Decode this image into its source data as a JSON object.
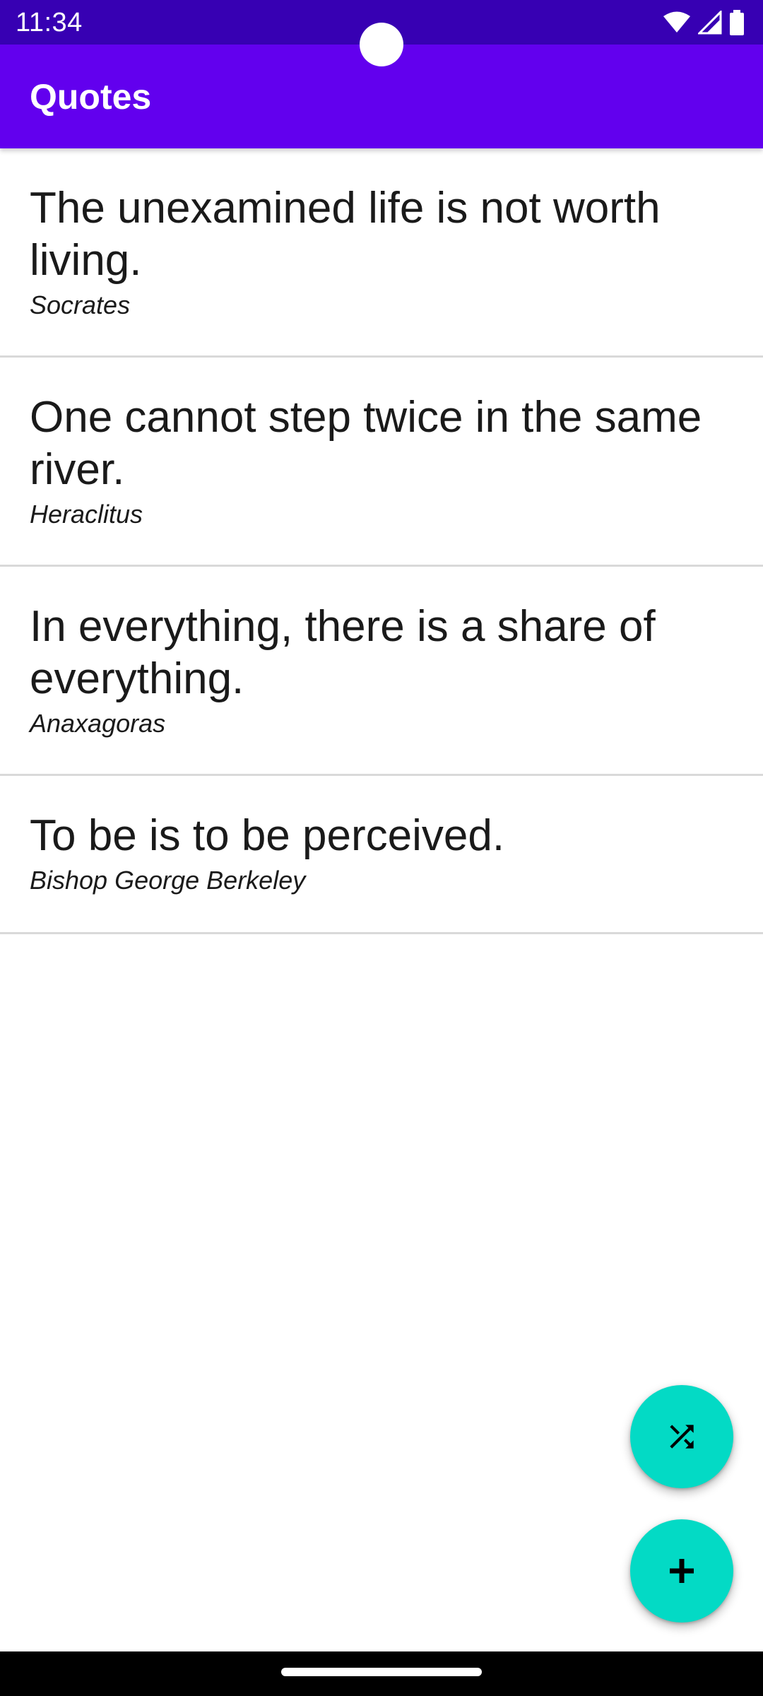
{
  "status_bar": {
    "time": "11:34",
    "icons": [
      "wifi-icon",
      "cellular-signal-icon",
      "battery-icon"
    ]
  },
  "app_bar": {
    "title": "Quotes"
  },
  "quotes": [
    {
      "text": "The unexamined life is not worth living.",
      "author": "Socrates"
    },
    {
      "text": "One cannot step twice in the same river.",
      "author": "Heraclitus"
    },
    {
      "text": "In everything, there is a share of everything.",
      "author": "Anaxagoras"
    },
    {
      "text": "To be is to be perceived.",
      "author": "Bishop George Berkeley"
    }
  ],
  "fabs": {
    "shuffle_icon": "shuffle-icon",
    "add_icon": "plus-icon"
  },
  "colors": {
    "status_bar": "#3700b3",
    "app_bar": "#6200ee",
    "fab": "#03dac5",
    "divider": "#d9d9d9"
  }
}
